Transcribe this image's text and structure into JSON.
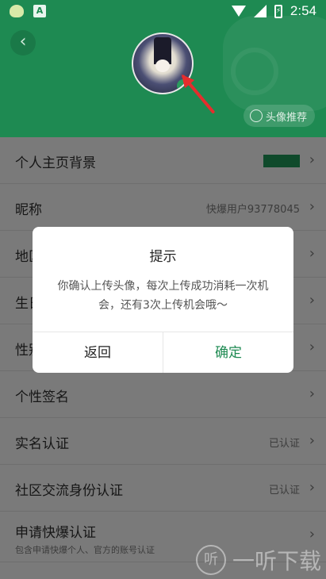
{
  "status_bar": {
    "time": "2:54",
    "battery_icon": "battery-charging-icon"
  },
  "header": {
    "avatar_recommend_label": "头像推荐"
  },
  "rows": [
    {
      "label": "个人主页背景",
      "value": ""
    },
    {
      "label": "昵称",
      "value": "快爆用户93778045"
    },
    {
      "label": "地区",
      "value": ""
    },
    {
      "label": "生日",
      "value": ""
    },
    {
      "label": "性别",
      "value": ""
    },
    {
      "label": "个性签名",
      "value": ""
    },
    {
      "label": "实名认证",
      "value": "已认证"
    },
    {
      "label": "社区交流身份认证",
      "value": "已认证"
    },
    {
      "label": "申请快爆认证",
      "sub": "包含申请快爆个人、官方的账号认证"
    }
  ],
  "dialog": {
    "title": "提示",
    "message": "你确认上传头像，每次上传成功消耗一次机会，还有3次上传机会哦～",
    "back_label": "返回",
    "ok_label": "确定"
  },
  "watermark": {
    "logo_text": "听",
    "text": "一听下载"
  },
  "colors": {
    "brand_green": "#1e8a52",
    "arrow_red": "#e52d2d"
  }
}
